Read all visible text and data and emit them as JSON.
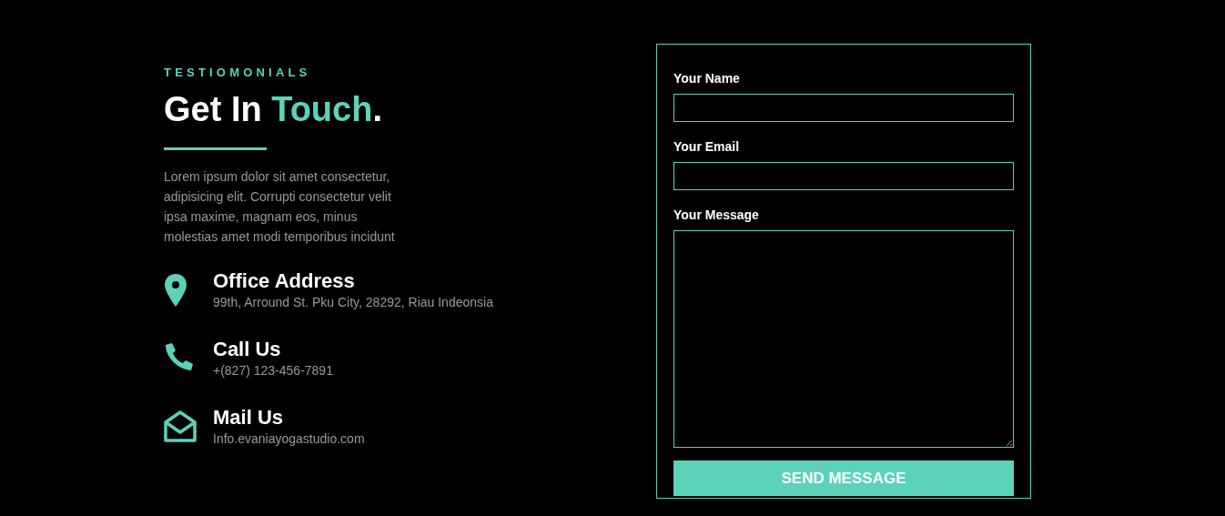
{
  "eyebrow": "TESTIOMONIALS",
  "heading": [
    {
      "text": "Get In ",
      "accent": false
    },
    {
      "text": "Touch",
      "accent": true
    },
    {
      "text": ".",
      "accent": false
    }
  ],
  "intro": "Lorem ipsum dolor sit amet consectetur, adipisicing elit. Corrupti consectetur velit ipsa maxime, magnam eos, minus molestias amet modi temporibus incidunt",
  "contacts": [
    {
      "kind": "address",
      "title": "Office Address",
      "detail": "99th, Arround St. Pku City, 28292, Riau Indeonsia"
    },
    {
      "kind": "phone",
      "title": "Call Us",
      "detail": "+(827) 123-456-7891"
    },
    {
      "kind": "mail",
      "title": "Mail Us",
      "detail": "Info.evaniayogastudio.com"
    }
  ],
  "form": {
    "fields": [
      {
        "kind": "text",
        "label": "Your Name"
      },
      {
        "kind": "text",
        "label": "Your Email"
      },
      {
        "kind": "textarea",
        "label": "Your Message"
      }
    ],
    "submit": "SEND MESSAGE"
  }
}
